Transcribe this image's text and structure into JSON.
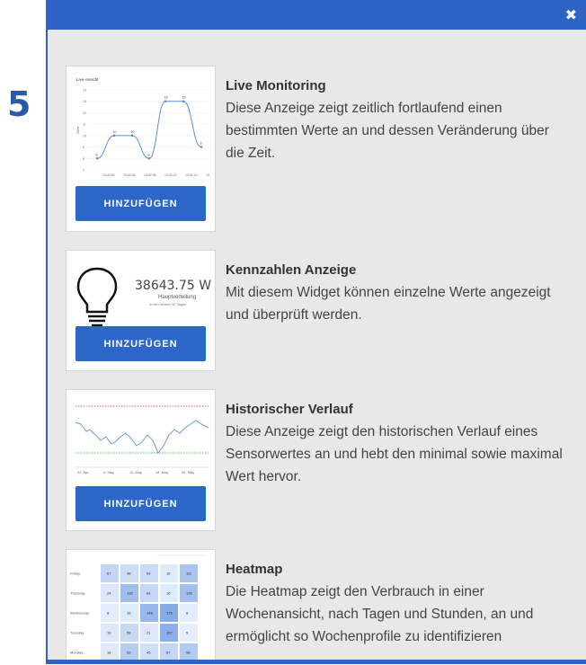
{
  "step": "5",
  "widgets": [
    {
      "title": "Live Monitoring",
      "description": "Diese Anzeige zeigt zeitlich fortlaufend einen bestimmten Werte an und dessen Veränderung über die Zeit.",
      "button": "HINZUFÜGEN",
      "preview": {
        "title": "Live-Ansicht",
        "ylabel": "Wert",
        "y_ticks": [
          "14",
          "13",
          "12",
          "11",
          "10",
          "9",
          "8",
          "7"
        ],
        "x_ticks": [
          "13:42:00",
          "13:42:04",
          "13:42:08",
          "13:42:12",
          "13:42:13",
          "13"
        ],
        "point_labels": [
          "8",
          "10",
          "10",
          "8",
          "13",
          "13",
          "9"
        ]
      }
    },
    {
      "title": "Kennzahlen Anzeige",
      "description": "Mit diesem Widget können einzelne Werte angezeigt und überprüft werden.",
      "button": "HINZUFÜGEN",
      "preview": {
        "value": "38643.75 W",
        "label": "Hauptverteilung",
        "sublabel": "in den letzten 30 Tagen"
      }
    },
    {
      "title": "Historischer Verlauf",
      "description": "Diese Anzeige zeigt den historischen Verlauf eines Sensorwertes an und hebt den minimal sowie maximal Wert hervor.",
      "button": "HINZUFÜGEN",
      "preview": {
        "x_ticks": [
          "22. Apr",
          "4. May",
          "11. May",
          "18. May",
          "25. May"
        ]
      }
    },
    {
      "title": "Heatmap",
      "description": "Die Heatmap zeigt den Verbrauch in einer Wochenansicht, nach Tagen und Stunden, an und ermöglicht so Wochenprofile zu identifizieren",
      "preview": {
        "rows": [
          {
            "day": "Friday",
            "values": [
              "67",
              "48",
              "54",
              "16",
              "111"
            ]
          },
          {
            "day": "Thursday",
            "values": [
              "24",
              "132",
              "64",
              "16",
              "126"
            ]
          },
          {
            "day": "Wednesday",
            "values": [
              "8",
              "16",
              "148",
              "176",
              "8"
            ]
          },
          {
            "day": "Tuesday",
            "values": [
              "19",
              "58",
              "21",
              "167",
              "5"
            ]
          },
          {
            "day": "Monday",
            "values": [
              "18",
              "92",
              "45",
              "67",
              "98"
            ]
          }
        ]
      }
    }
  ]
}
